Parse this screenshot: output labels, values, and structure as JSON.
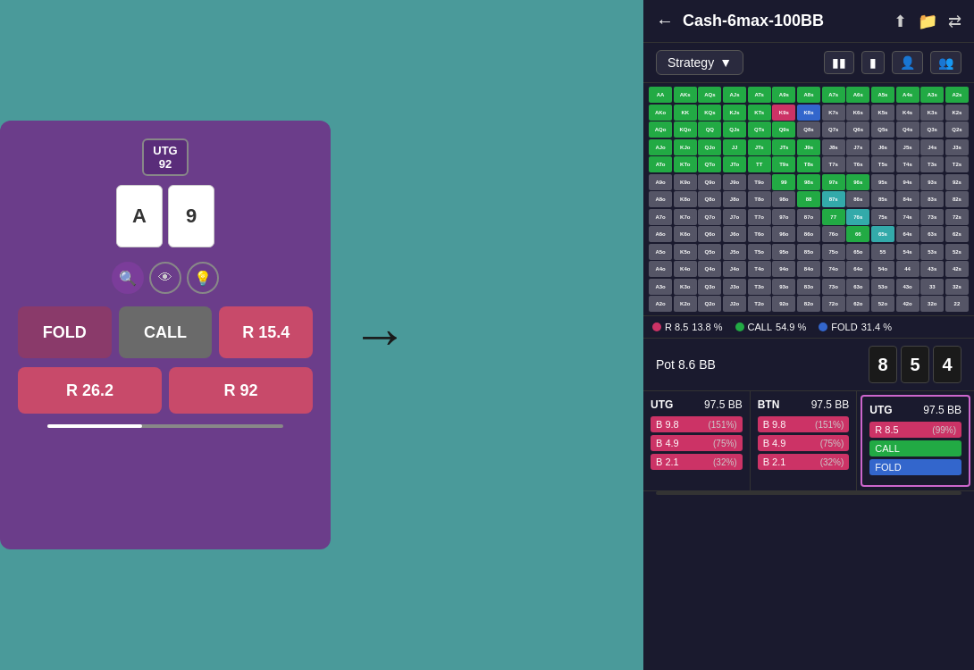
{
  "left": {
    "position": "UTG",
    "number": "92",
    "card1": "A",
    "card2": "9",
    "fold_label": "FOLD",
    "call_label": "CALL",
    "raise1_label": "R 15.4",
    "raise2_label": "R 26.2",
    "raise3_label": "R 92"
  },
  "arrow": "→",
  "right": {
    "title": "Cash-6max-100BB",
    "strategy_label": "Strategy",
    "back_icon": "←",
    "share_icon": "⬆",
    "folder_icon": "📁",
    "flip_icon": "⇄",
    "grid_icon": "▦",
    "person_icon": "👤",
    "people_icon": "👥",
    "legend": [
      {
        "label": "R 8.5",
        "pct": "13.8 %",
        "color": "#cc3366"
      },
      {
        "label": "CALL",
        "pct": "54.9 %",
        "color": "#22aa44"
      },
      {
        "label": "FOLD",
        "pct": "31.4 %",
        "color": "#3366cc"
      }
    ],
    "pot_label": "Pot 8.6 BB",
    "board_cards": [
      "8",
      "5",
      "4"
    ],
    "players": [
      {
        "pos": "UTG",
        "bb": "97.5 BB",
        "actions": [
          {
            "label": "9.8",
            "prefix": "B",
            "pct": "(151%)",
            "type": "raise"
          },
          {
            "label": "4.9",
            "prefix": "B",
            "pct": "(75%)",
            "type": "raise"
          },
          {
            "label": "2.1",
            "prefix": "B",
            "pct": "(32%)",
            "type": "raise"
          }
        ]
      },
      {
        "pos": "BTN",
        "bb": "97.5 BB",
        "actions": [
          {
            "label": "9.8",
            "prefix": "B",
            "pct": "(151%)",
            "type": "raise"
          },
          {
            "label": "4.9",
            "prefix": "B",
            "pct": "(75%)",
            "type": "raise"
          },
          {
            "label": "2.1",
            "prefix": "B",
            "pct": "(32%)",
            "type": "raise"
          }
        ]
      },
      {
        "pos": "UTG",
        "bb": "97.5 BB",
        "actions": [
          {
            "label": "R 8.5",
            "prefix": "",
            "pct": "(99%)",
            "type": "raise"
          },
          {
            "label": "CALL",
            "prefix": "",
            "pct": "",
            "type": "call"
          },
          {
            "label": "FOLD",
            "prefix": "",
            "pct": "",
            "type": "fold"
          }
        ],
        "highlighted": true
      }
    ],
    "range_colors": {
      "green": "#22aa44",
      "blue": "#3366cc",
      "red": "#cc3366",
      "teal": "#22aaaa",
      "purple": "#8855cc",
      "gray": "#555566",
      "orange": "#cc7722",
      "mixed_green_blue": "#448866"
    },
    "hands": [
      [
        "AA",
        "AKs",
        "AQs",
        "AJs",
        "ATs",
        "A9s",
        "A8s",
        "A7s",
        "A6s",
        "A5s",
        "A4s",
        "A3s",
        "A2s"
      ],
      [
        "AKo",
        "KK",
        "KQs",
        "KJs",
        "KTs",
        "K9s",
        "K8s",
        "K7s",
        "K6s",
        "K5s",
        "K4s",
        "K3s",
        "K2s"
      ],
      [
        "AQo",
        "KQo",
        "QQ",
        "QJs",
        "QTs",
        "Q9s",
        "Q8s",
        "Q7s",
        "Q6s",
        "Q5s",
        "Q4s",
        "Q3s",
        "Q2s"
      ],
      [
        "AJo",
        "KJo",
        "QJo",
        "JJ",
        "JTs",
        "JTs",
        "J9s",
        "J8s",
        "J7s",
        "J6s",
        "J5s",
        "J4s",
        "J3s"
      ],
      [
        "ATo",
        "KTo",
        "QTo",
        "JTo",
        "TT",
        "T9s",
        "T8s",
        "T7s",
        "T6s",
        "T5s",
        "T4s",
        "T3s",
        "T2s"
      ],
      [
        "A9o",
        "K9o",
        "Q9o",
        "J9o",
        "T9o",
        "99",
        "98s",
        "97s",
        "96s",
        "95s",
        "94s",
        "93s",
        "92s"
      ],
      [
        "A8o",
        "K8o",
        "Q8o",
        "J8o",
        "T8o",
        "98o",
        "88",
        "87s",
        "86s",
        "85s",
        "84s",
        "83s",
        "82s"
      ],
      [
        "A7o",
        "K7o",
        "Q7o",
        "J7o",
        "T7o",
        "97o",
        "87o",
        "77",
        "76s",
        "75s",
        "74s",
        "73s",
        "72s"
      ],
      [
        "A6o",
        "K6o",
        "Q6o",
        "J6o",
        "T6o",
        "96o",
        "86o",
        "76o",
        "66",
        "65s",
        "64s",
        "63s",
        "62s"
      ],
      [
        "A5o",
        "K5o",
        "Q5o",
        "J5o",
        "T5o",
        "95o",
        "85o",
        "75o",
        "65o",
        "55",
        "54s",
        "53s",
        "52s"
      ],
      [
        "A4o",
        "K4o",
        "Q4o",
        "J4o",
        "T4o",
        "94o",
        "84o",
        "74o",
        "64o",
        "54o",
        "44",
        "43s",
        "42s"
      ],
      [
        "A3o",
        "K3o",
        "Q3o",
        "J3o",
        "T3o",
        "93o",
        "83o",
        "73o",
        "63o",
        "53o",
        "43o",
        "33",
        "32s"
      ],
      [
        "A2o",
        "K2o",
        "Q2o",
        "J2o",
        "T2o",
        "92o",
        "82o",
        "72o",
        "62o",
        "52o",
        "42o",
        "32o",
        "22"
      ]
    ],
    "hand_colors": {
      "AA": "green",
      "AKs": "green",
      "AQs": "green",
      "AJs": "green",
      "ATs": "green",
      "A9s": "green",
      "A8s": "green",
      "A7s": "green",
      "A6s": "green",
      "A5s": "green",
      "A4s": "green",
      "A3s": "green",
      "A2s": "green",
      "AKo": "green",
      "KK": "green",
      "KQs": "green",
      "KJs": "green",
      "KTs": "green",
      "K9s": "red",
      "K8s": "blue",
      "K7s": "gray",
      "K6s": "gray",
      "K5s": "gray",
      "K4s": "gray",
      "K3s": "gray",
      "K2s": "gray",
      "AQo": "green",
      "KQo": "green",
      "QQ": "green",
      "QJs": "green",
      "QTs": "green",
      "Q9s": "green",
      "Q8s": "gray",
      "Q7s": "gray",
      "Q6s": "gray",
      "Q5s": "gray",
      "Q4s": "gray",
      "Q3s": "gray",
      "Q2s": "gray",
      "AJo": "green",
      "KJo": "green",
      "QJo": "green",
      "JJ": "green",
      "JTs": "green",
      "J9s": "green",
      "J8s": "gray",
      "J7s": "gray",
      "J6s": "gray",
      "J5s": "gray",
      "J4s": "gray",
      "J3s": "gray",
      "J2s": "gray",
      "ATo": "green",
      "KTo": "green",
      "QTo": "green",
      "JTo": "green",
      "TT": "green",
      "T9s": "green",
      "T8s": "green",
      "T7s": "gray",
      "T6s": "gray",
      "T5s": "gray",
      "T4s": "gray",
      "T3s": "gray",
      "T2s": "gray",
      "A9o": "gray",
      "K9o": "gray",
      "Q9o": "gray",
      "J9o": "gray",
      "T9o": "gray",
      "99": "green",
      "98s": "green",
      "97s": "green",
      "96s": "green",
      "95s": "gray",
      "94s": "gray",
      "93s": "gray",
      "92s": "gray",
      "A8o": "gray",
      "K8o": "gray",
      "Q8o": "gray",
      "J8o": "gray",
      "T8o": "gray",
      "98o": "gray",
      "88": "green",
      "87s": "teal",
      "86s": "gray",
      "85s": "gray",
      "84s": "gray",
      "83s": "gray",
      "82s": "gray",
      "A7o": "gray",
      "K7o": "gray",
      "Q7o": "gray",
      "J7o": "gray",
      "T7o": "gray",
      "97o": "gray",
      "87o": "gray",
      "77": "green",
      "76s": "teal",
      "75s": "gray",
      "74s": "gray",
      "73s": "gray",
      "72s": "gray",
      "A6o": "gray",
      "K6o": "gray",
      "Q6o": "gray",
      "J6o": "gray",
      "T6o": "gray",
      "96o": "gray",
      "86o": "gray",
      "76o": "gray",
      "66": "green",
      "65s": "teal",
      "64s": "gray",
      "63s": "gray",
      "62s": "gray",
      "A5o": "gray",
      "K5o": "gray",
      "Q5o": "gray",
      "J5o": "gray",
      "T5o": "gray",
      "95o": "gray",
      "85o": "gray",
      "75o": "gray",
      "65o": "gray",
      "55": "orange",
      "54s": "gray",
      "53s": "gray",
      "52s": "gray",
      "A4o": "gray",
      "K4o": "gray",
      "Q4o": "gray",
      "J4o": "gray",
      "T4o": "gray",
      "94o": "gray",
      "84o": "gray",
      "74o": "gray",
      "64o": "gray",
      "54o": "gray",
      "44": "gray",
      "43s": "gray",
      "42s": "gray",
      "A3o": "gray",
      "K3o": "gray",
      "Q3o": "gray",
      "J3o": "gray",
      "T3o": "gray",
      "93o": "gray",
      "83o": "gray",
      "73o": "gray",
      "63o": "gray",
      "53o": "gray",
      "43o": "gray",
      "33": "gray",
      "32s": "gray",
      "A2o": "gray",
      "K2o": "gray",
      "Q2o": "gray",
      "J2o": "gray",
      "T2o": "gray",
      "92o": "gray",
      "82o": "gray",
      "72o": "gray",
      "62o": "gray",
      "52o": "gray",
      "42o": "gray",
      "32o": "gray",
      "22": "gray"
    }
  }
}
